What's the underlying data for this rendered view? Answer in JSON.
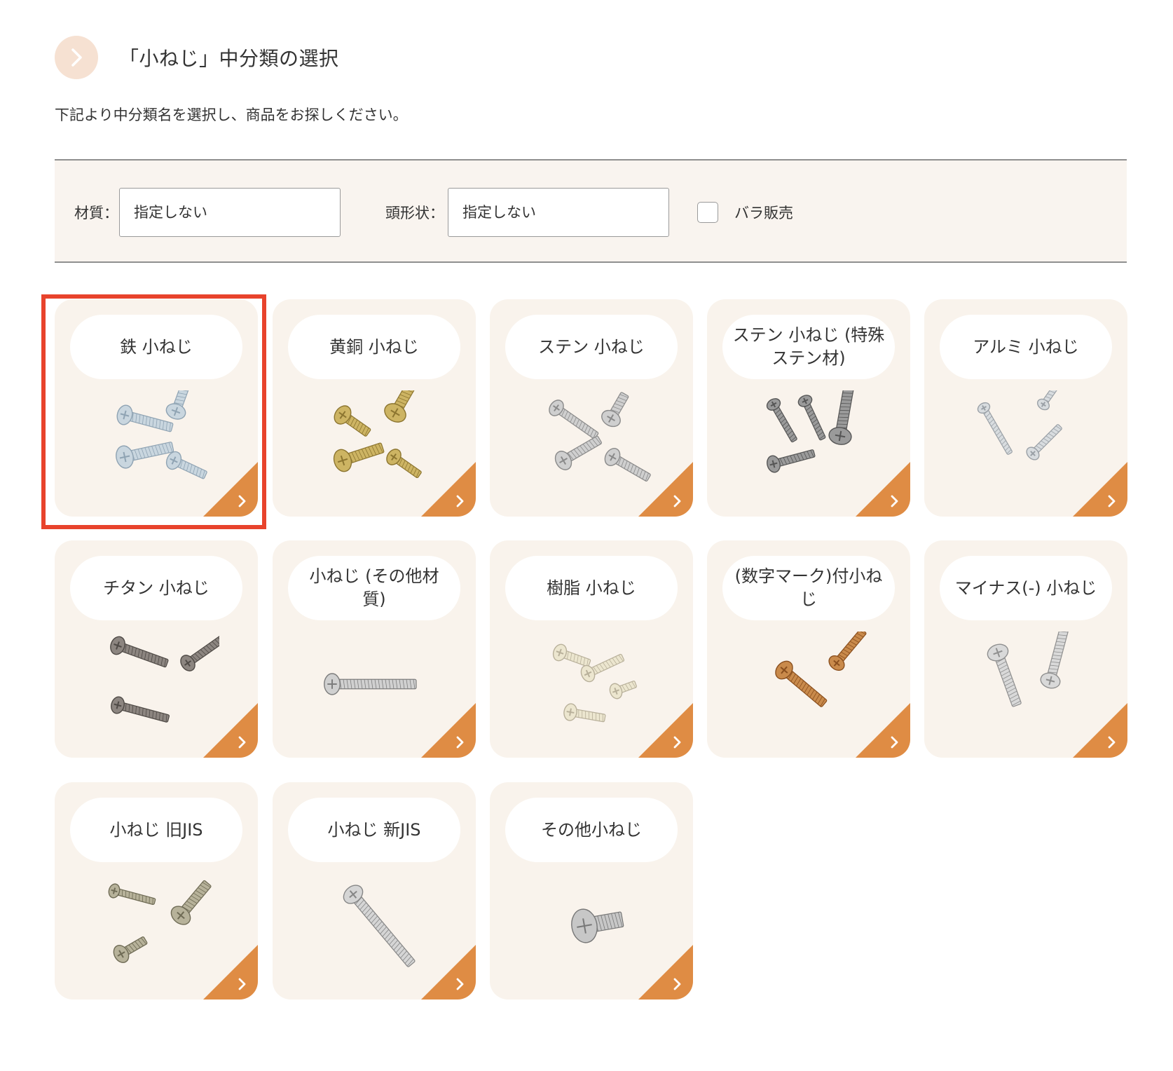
{
  "header": {
    "title": "「小ねじ」中分類の選択",
    "icon": "chevron-right-icon"
  },
  "description": "下記より中分類名を選択し、商品をお探しください。",
  "filters": {
    "material_label": "材質：",
    "material_value": "指定しない",
    "head_shape_label": "頭形状：",
    "head_shape_value": "指定しない",
    "bulk_label": "バラ販売",
    "bulk_checked": false
  },
  "categories": [
    {
      "label": "鉄 小ねじ",
      "icon": "steel-screws-image"
    },
    {
      "label": "黄銅 小ねじ",
      "icon": "brass-screws-image"
    },
    {
      "label": "ステン 小ねじ",
      "icon": "stainless-screws-image"
    },
    {
      "label": "ステン 小ねじ (特殊ステン材)",
      "icon": "special-stainless-screws-image"
    },
    {
      "label": "アルミ 小ねじ",
      "icon": "aluminum-screws-image"
    },
    {
      "label": "チタン 小ねじ",
      "icon": "titanium-screws-image"
    },
    {
      "label": "小ねじ (その他材質)",
      "icon": "other-material-screw-image"
    },
    {
      "label": "樹脂 小ねじ",
      "icon": "resin-screws-image"
    },
    {
      "label": "(数字マーク)付小ねじ",
      "icon": "numbered-screws-image"
    },
    {
      "label": "マイナス(-) 小ねじ",
      "icon": "slotted-screws-image"
    },
    {
      "label": "小ねじ 旧JIS",
      "icon": "old-jis-screws-image"
    },
    {
      "label": "小ねじ 新JIS",
      "icon": "new-jis-screw-image"
    },
    {
      "label": "その他小ねじ",
      "icon": "other-screw-image"
    }
  ],
  "selected_category_index": 0,
  "colors": {
    "card_bg": "#f9f3ec",
    "accent": "#df8c44",
    "highlight": "#e8432c",
    "icon_circle": "#f6e1d2"
  }
}
